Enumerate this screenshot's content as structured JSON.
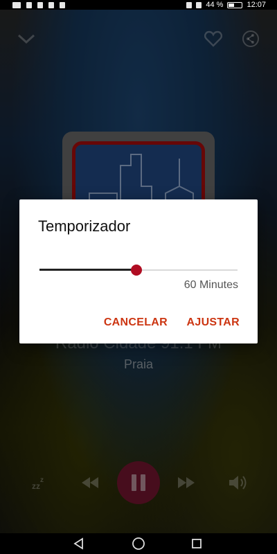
{
  "status_bar": {
    "battery_percent": "44 %",
    "time": "12:07",
    "battery_level": 0.44,
    "icons": [
      "notification-icon",
      "signal-icon",
      "wifi-icon",
      "bluetooth-icon",
      "eye-icon",
      "battery-icon"
    ]
  },
  "player": {
    "station_name": "Radio Cidade 91.1 FM",
    "station_location": "Praia",
    "accent_color": "#7a1733",
    "icons": {
      "collapse": "chevron-down-icon",
      "favorite": "heart-icon",
      "share": "share-icon",
      "sleep": "sleep-timer-icon",
      "previous": "rewind-icon",
      "play_pause": "pause-icon",
      "next": "fast-forward-icon",
      "volume": "volume-icon"
    }
  },
  "dialog": {
    "title": "Temporizador",
    "slider_fraction": 0.49,
    "value_label": "60 Minutes",
    "cancel_label": "CANCELAR",
    "ok_label": "AJUSTAR",
    "accent_color": "#cc3511",
    "thumb_color": "#b00d22"
  },
  "nav_bar": {
    "icons": [
      "back-icon",
      "home-icon",
      "recents-icon"
    ]
  }
}
